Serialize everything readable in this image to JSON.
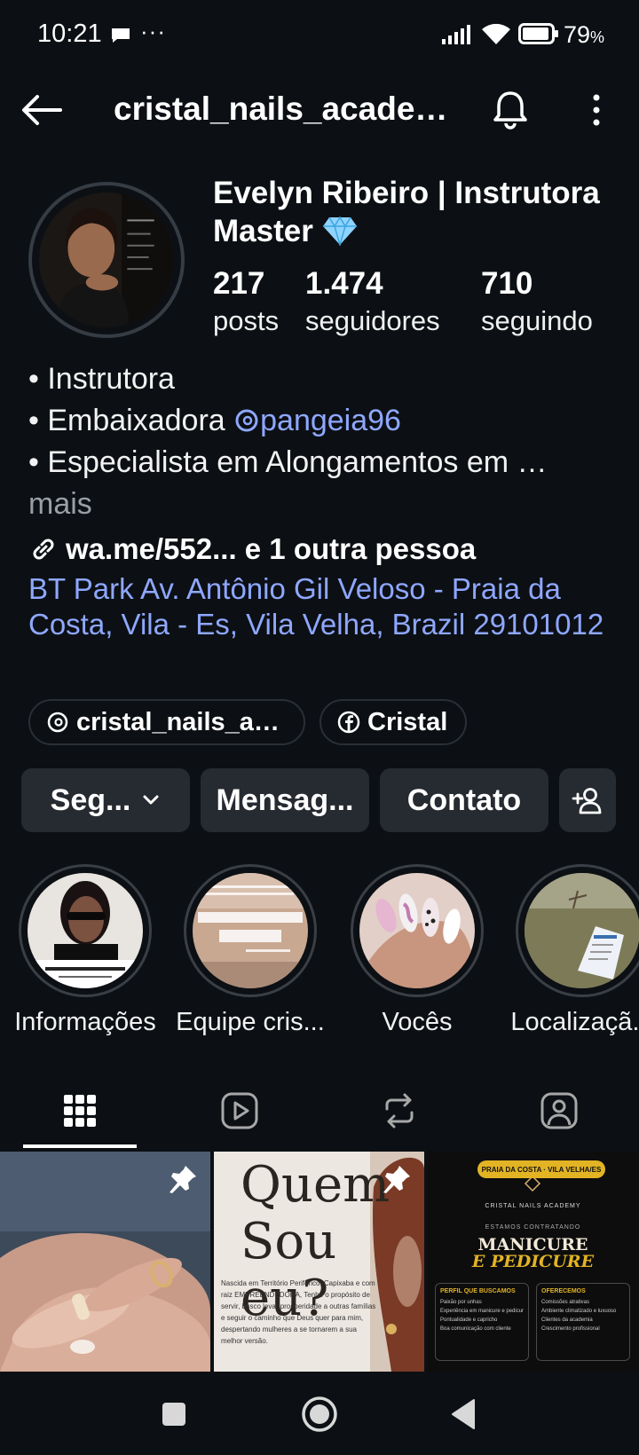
{
  "status_bar": {
    "time": "10:21",
    "more": "···",
    "battery": "79",
    "battery_unit": "%"
  },
  "header": {
    "username": "cristal_nails_academy"
  },
  "profile": {
    "name": "Evelyn Ribeiro | Instrutora Master",
    "stats": [
      {
        "value": "217",
        "label": "posts"
      },
      {
        "value": "1.474",
        "label": "seguidores"
      },
      {
        "value": "710",
        "label": "seguindo"
      }
    ],
    "bio": {
      "line1": "• Instrutora",
      "line2_prefix": "• Embaixadora ",
      "line2_mention": "pangeia96",
      "line3": "• Especialista em Alongamentos em …",
      "more": "mais"
    },
    "link": "wa.me/552... e 1 outra pessoa",
    "address": "BT Park Av. Antônio Gil Veloso - Praia da Costa, Vila - Es, Vila Velha, Brazil 29101012",
    "chips": {
      "threads": "cristal_nails_academy",
      "facebook": "Cristal"
    }
  },
  "actions": {
    "follow": "Seg...",
    "message": "Mensag...",
    "contact": "Contato"
  },
  "highlights": [
    {
      "label": "Informações",
      "icon": "highlight-info"
    },
    {
      "label": "Equipe cris...",
      "icon": "highlight-team"
    },
    {
      "label": "Vocês",
      "icon": "highlight-nails"
    },
    {
      "label": "Localizaçã...",
      "icon": "highlight-location"
    }
  ],
  "tabs": [
    {
      "icon": "grid-icon",
      "active": true
    },
    {
      "icon": "reels-icon",
      "active": false
    },
    {
      "icon": "repost-icon",
      "active": false
    },
    {
      "icon": "tagged-icon",
      "active": false
    }
  ],
  "posts": {
    "p2_title_1": "Quem",
    "p2_title_2": "Sou eu?",
    "p2_body": "Nascida em Território Periférico, Capixaba e com raiz EMPREENDEDORA, Tenho o propósito de servir, busco levar prosperidade a outras famílias e seguir o caminho que Deus quer para mim, despertando mulheres a se tornarem a sua melhor versão.",
    "p3_badge": "PRAIA DA COSTA · VILA VELHA/ES",
    "p3_brand": "CRISTAL NAILS ACADEMY",
    "p3_hiring": "ESTAMOS CONTRATANDO",
    "p3_role_1": "MANICURE",
    "p3_role_2": "E PEDICURE",
    "p3_left_head": "PERFIL QUE BUSCAMOS",
    "p3_left_items": [
      "Paixão por unhas",
      "Experiência em manicure e pedicure",
      "Pontualidade e capricho",
      "Boa comunicação com cliente"
    ],
    "p3_right_head": "OFERECEMOS",
    "p3_right_items": [
      "Comissões atrativas",
      "Ambiente climatizado e luxuoso",
      "Clientes da academia",
      "Crescimento profissional"
    ]
  },
  "colors": {
    "background": "#0c1014",
    "button": "#262a31",
    "link_blue": "#8fa7ff",
    "accent_gold": "#e2b424"
  }
}
